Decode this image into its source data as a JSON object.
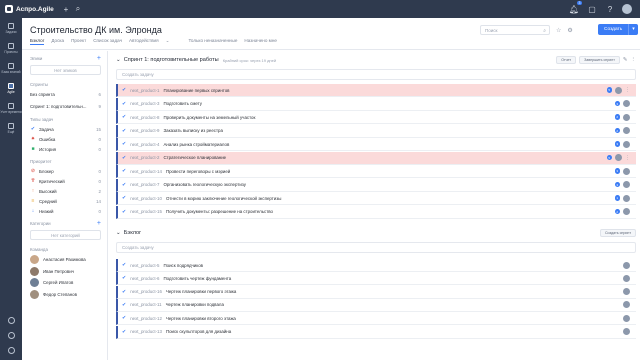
{
  "app": {
    "logo_text": "Аспро.Agile",
    "notif_count": "3"
  },
  "rail": [
    {
      "label": "Задачи"
    },
    {
      "label": "Проекты"
    },
    {
      "label": "База знаний"
    },
    {
      "label": "Agile"
    },
    {
      "label": "Учет времени"
    },
    {
      "label": "Ещё"
    }
  ],
  "header": {
    "title": "Строительство ДК им. Элронда",
    "tabs": [
      "Бэклог",
      "Доска",
      "Проект",
      "Список задач",
      "Автодействия"
    ],
    "filter_unassigned": "Только неназначенные",
    "filter_mine": "Назначено мне",
    "search_placeholder": "Поиск",
    "create_label": "Создать"
  },
  "sidebar": {
    "epics_label": "Эпики",
    "epics_empty": "Нет эпиков",
    "sprints_label": "Спринты",
    "sprints": [
      {
        "label": "Без спринта",
        "count": "6"
      },
      {
        "label": "Спринт 1: подготовительн...",
        "count": "9"
      }
    ],
    "types_label": "Типы задач",
    "types": [
      {
        "label": "Задача",
        "count": "15"
      },
      {
        "label": "Ошибка",
        "count": "0"
      },
      {
        "label": "История",
        "count": "0"
      }
    ],
    "priority_label": "Приоритет",
    "priorities": [
      {
        "label": "Блокер",
        "count": "0"
      },
      {
        "label": "Критический",
        "count": "0"
      },
      {
        "label": "Высокий",
        "count": "2"
      },
      {
        "label": "Средний",
        "count": "14"
      },
      {
        "label": "Низкий",
        "count": "0"
      }
    ],
    "categories_label": "Категории",
    "categories_empty": "Нет категорий",
    "team_label": "Команда",
    "team": [
      {
        "name": "Анастасия Рахимова"
      },
      {
        "name": "Иван Петрович"
      },
      {
        "name": "Сергей Ипатов"
      },
      {
        "name": "Федор Степанов"
      }
    ]
  },
  "sprint": {
    "title": "Спринт 1: подготовительные работы",
    "subtitle": "Крайний срок: через 19 дней",
    "btn_close": "Отчет",
    "btn_complete": "Завершить спринт",
    "create_placeholder": "Создать задачу",
    "tasks": [
      {
        "key": "next_product-1",
        "title": "Планирование первых спринтов",
        "highlight": true,
        "points": "5"
      },
      {
        "key": "next_product-3",
        "title": "Подготовить смету",
        "highlight": false,
        "points": "3"
      },
      {
        "key": "next_product-8",
        "title": "Проверить документы на земельный участок",
        "highlight": false,
        "points": "2"
      },
      {
        "key": "next_product-9",
        "title": "Заказать выписку из реестра",
        "highlight": false,
        "points": "2"
      },
      {
        "key": "next_product-4",
        "title": "Анализ рынка стройматериалов",
        "highlight": false,
        "points": "3"
      },
      {
        "key": "next_product-2",
        "title": "Стратегическое планирование",
        "highlight": true,
        "points": "5"
      },
      {
        "key": "next_product-14",
        "title": "Провести переговоры с мэрией",
        "highlight": false,
        "points": "3"
      },
      {
        "key": "next_product-7",
        "title": "Организовать геологическую экспертизу",
        "highlight": false,
        "points": "3"
      },
      {
        "key": "next_product-10",
        "title": "Отнести в мэрию заключение геологической экспертизы",
        "highlight": false,
        "points": "1"
      },
      {
        "key": "next_product-15",
        "title": "Получить документы: разрешение на строительство",
        "highlight": false,
        "points": "2"
      }
    ]
  },
  "backlog": {
    "title": "Бэклог",
    "btn_create_sprint": "Создать спринт",
    "create_placeholder": "Создать задачу",
    "tasks": [
      {
        "key": "next_product-5",
        "title": "Поиск подрядчиков"
      },
      {
        "key": "next_product-6",
        "title": "Подготовить чертеж фундамента"
      },
      {
        "key": "next_product-16",
        "title": "Чертеж планировки первого этажа"
      },
      {
        "key": "next_product-11",
        "title": "Чертеж планировки подвала"
      },
      {
        "key": "next_product-12",
        "title": "Чертеж планировки второго этажа"
      },
      {
        "key": "next_product-13",
        "title": "Поиск скульпторов для дизайна"
      }
    ]
  },
  "colors": {
    "accent": "#3b7cf5",
    "topbar": "#2f3a4e",
    "highlight_row": "#fbdada"
  }
}
